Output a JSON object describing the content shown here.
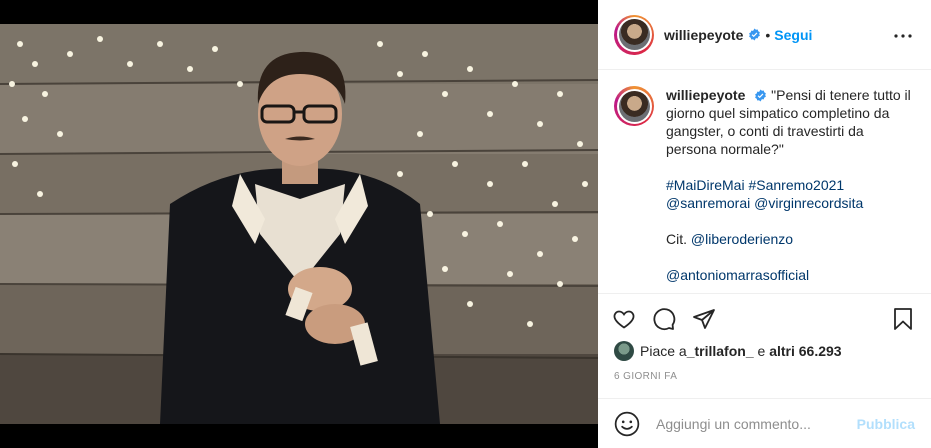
{
  "post": {
    "username": "williepeyote",
    "follow_label": "Segui",
    "separator": "•",
    "caption": {
      "username": "williepeyote",
      "quote": "\"Pensi di tenere tutto il giorno quel simpatico completino da gangster, o conti di travestirti da persona normale?\"",
      "hashtags": "#MaiDireMai #Sanremo2021",
      "mentions": "@sanremorai @virginrecordsita",
      "cit_prefix": "Cit. ",
      "cit_mention": "@liberoderienzo",
      "extra_mention": "@antoniomarrasofficial"
    },
    "likes": {
      "prefix": "Piace a ",
      "user": "_trillafon_",
      "middle": " e ",
      "others": "altri 66.293"
    },
    "date": "6 GIORNI FA",
    "comment": {
      "placeholder": "Aggiungi un commento...",
      "publish_label": "Pubblica"
    }
  },
  "colors": {
    "accent": "#0095f6",
    "link": "#00376b",
    "publish_disabled": "#b2dffc",
    "muted": "#8e8e8e"
  },
  "icons": {
    "more": "more-horizontal-icon",
    "like": "heart-icon",
    "comment": "comment-icon",
    "share": "paper-plane-icon",
    "save": "bookmark-icon",
    "emoji": "smiley-icon",
    "verified": "verified-badge-icon"
  }
}
